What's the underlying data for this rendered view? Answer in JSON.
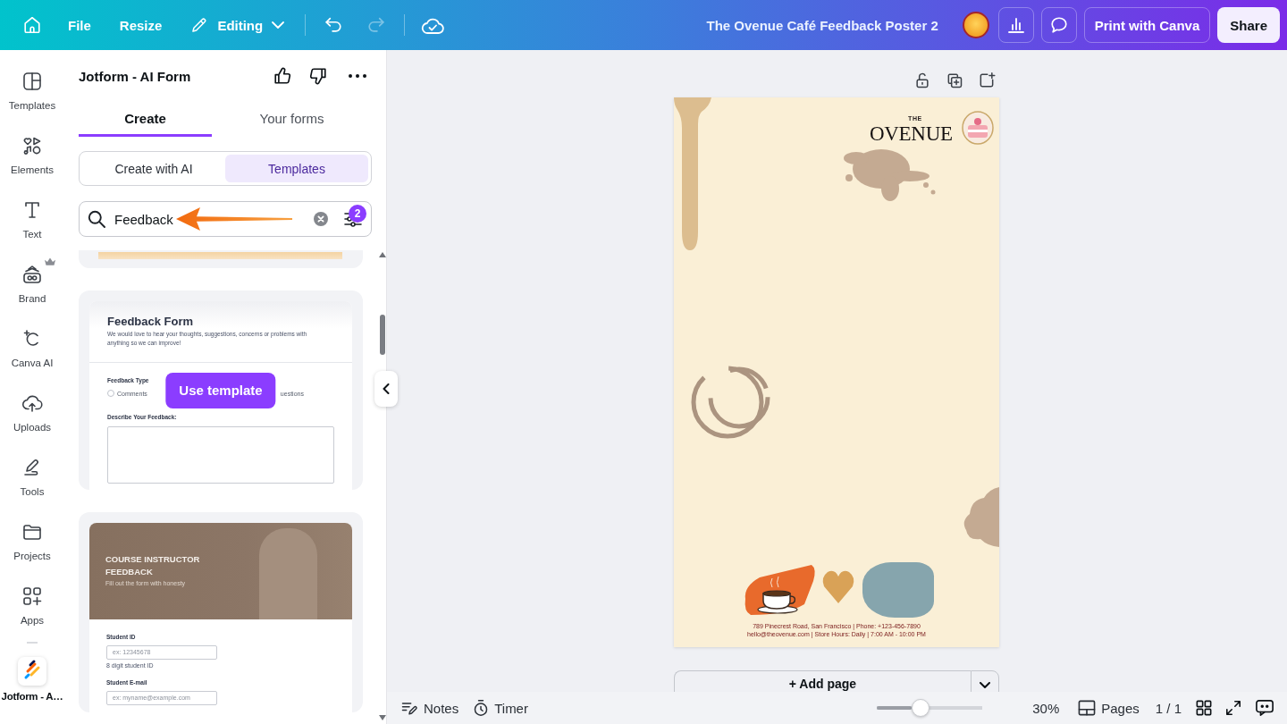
{
  "top_bar": {
    "menu": [
      {
        "label": "File"
      },
      {
        "label": "Resize"
      }
    ],
    "mode": {
      "label": "Editing"
    },
    "history": [
      {
        "kind": "undo",
        "disabled": false
      },
      {
        "kind": "redo",
        "disabled": true
      }
    ],
    "document_title": "The Ovenue Café Feedback Poster 2",
    "actions": [
      {
        "label": "Print with Canva",
        "kind": "outline"
      },
      {
        "label": "Share",
        "kind": "solid"
      }
    ]
  },
  "sidebar": {
    "items": [
      {
        "label": "Templates",
        "premium": false
      },
      {
        "label": "Elements",
        "premium": false
      },
      {
        "label": "Text",
        "premium": false
      },
      {
        "label": "Brand",
        "premium": true
      },
      {
        "label": "Canva AI",
        "premium": false
      },
      {
        "label": "Uploads",
        "premium": false
      },
      {
        "label": "Tools",
        "premium": false
      },
      {
        "label": "Projects",
        "premium": false
      },
      {
        "label": "Apps",
        "premium": false
      }
    ],
    "apps": [
      {
        "label": "Jotform - A…"
      }
    ]
  },
  "panel": {
    "title": "Jotform - AI Form",
    "tabs": [
      {
        "label": "Create",
        "selected": true
      },
      {
        "label": "Your forms",
        "selected": false
      }
    ],
    "modes": [
      {
        "label": "Create with AI",
        "selected": false
      },
      {
        "label": "Templates",
        "selected": true
      }
    ],
    "search": {
      "value": "Feedback",
      "filter_count": "2"
    },
    "templates": [
      {
        "kind": "image"
      },
      {
        "kind": "form",
        "title": "Feedback Form",
        "description": "We would love to hear your thoughts, suggestions, concerns or problems with anything so we can improve!",
        "fields": [
          {
            "kind": "radio",
            "label": "Feedback Type",
            "options": [
              {
                "kind": "radio",
                "label": "Comments",
                "checked": false
              },
              {
                "kind": "text",
                "label": "uestions"
              }
            ]
          },
          {
            "kind": "textarea",
            "label": "Describe Your Feedback:"
          }
        ],
        "action": "Use template"
      },
      {
        "kind": "banner_form",
        "title": "COURSE INSTRUCTOR FEEDBACK",
        "subtitle": "Fill out the form with honesty",
        "fields": [
          {
            "kind": "text",
            "label": "Student ID",
            "placeholder": "ex: 12345678",
            "hint": "8 digit student ID"
          },
          {
            "kind": "text",
            "label": "Student E-mail",
            "placeholder": "ex: myname@example.com"
          }
        ]
      }
    ]
  },
  "canvas": {
    "poster": {
      "logo_top": "THE",
      "logo": "OVENUE",
      "footer_lines": [
        "789 Pinecrest Road, San Francisco | Phone: +123-456-7890",
        "hello@theovenue.com | Store Hours: Daily | 7:00 AM - 10:00 PM"
      ]
    },
    "add_page": "+ Add page"
  },
  "status_bar": {
    "notes": "Notes",
    "timer": "Timer",
    "zoom": {
      "level": 0.41,
      "reading": "30%"
    },
    "pages": "Pages",
    "page_count": "1 / 1"
  }
}
